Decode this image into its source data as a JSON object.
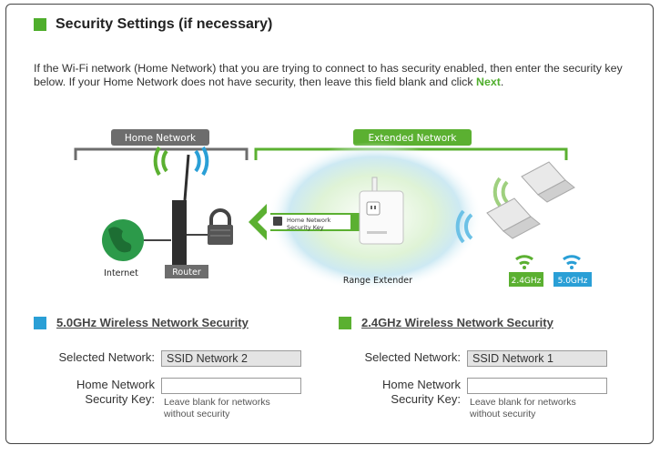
{
  "section": {
    "title": "Security Settings (if necessary)",
    "accent_color": "#4fae2c",
    "intro_prefix": "If the Wi-Fi network (Home Network) that you are trying to connect to has security enabled, then enter the security key below. If your Home Network does not have security, then leave this field blank and click ",
    "intro_link": "Next",
    "intro_suffix": "."
  },
  "diagram": {
    "home_network_label": "Home Network",
    "extended_network_label": "Extended Network",
    "internet_label": "Internet",
    "router_label": "Router",
    "arrow_line1": "Home Network",
    "arrow_line2": "Security Key",
    "range_extender_label": "Range Extender",
    "band_24_label": "2.4GHz",
    "band_50_label": "5.0GHz",
    "colors": {
      "green": "#5bb031",
      "blue": "#2a9fd6",
      "gray_label": "#6d6d6d"
    }
  },
  "band_5g": {
    "title": "5.0GHz Wireless Network Security",
    "color": "#2a9fd6",
    "selected_network_label": "Selected Network:",
    "selected_network_value": "SSID Network 2",
    "key_label_line1": "Home Network",
    "key_label_line2": "Security Key:",
    "key_value": "",
    "hint_line1": "Leave blank for networks",
    "hint_line2": "without security"
  },
  "band_24g": {
    "title": "2.4GHz Wireless Network Security",
    "color": "#5bb031",
    "selected_network_label": "Selected Network:",
    "selected_network_value": "SSID Network 1",
    "key_label_line1": "Home Network",
    "key_label_line2": "Security Key:",
    "key_value": "",
    "hint_line1": "Leave blank for networks",
    "hint_line2": "without security"
  }
}
